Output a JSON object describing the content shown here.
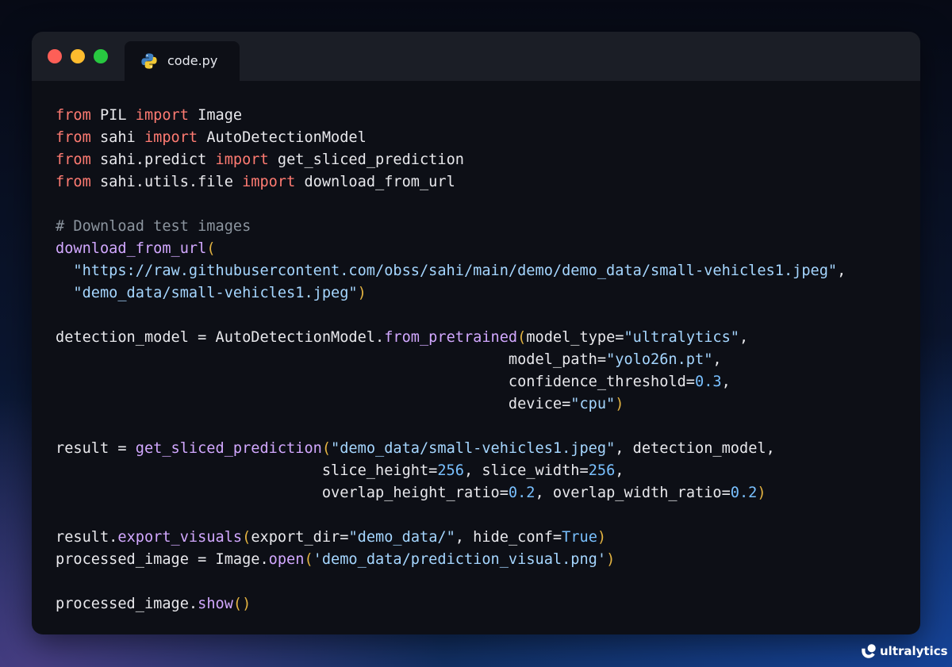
{
  "tab": {
    "label": "code.py",
    "icon": "python-icon"
  },
  "code_lines": [
    [
      [
        "kw",
        "from"
      ],
      [
        "tx",
        " PIL "
      ],
      [
        "kw",
        "import"
      ],
      [
        "tx",
        " Image"
      ]
    ],
    [
      [
        "kw",
        "from"
      ],
      [
        "tx",
        " sahi "
      ],
      [
        "kw",
        "import"
      ],
      [
        "tx",
        " AutoDetectionModel"
      ]
    ],
    [
      [
        "kw",
        "from"
      ],
      [
        "tx",
        " sahi.predict "
      ],
      [
        "kw",
        "import"
      ],
      [
        "tx",
        " get_sliced_prediction"
      ]
    ],
    [
      [
        "kw",
        "from"
      ],
      [
        "tx",
        " sahi.utils.file "
      ],
      [
        "kw",
        "import"
      ],
      [
        "tx",
        " download_from_url"
      ]
    ],
    [],
    [
      [
        "cm",
        "# Download test images"
      ]
    ],
    [
      [
        "fn",
        "download_from_url"
      ],
      [
        "pn",
        "("
      ]
    ],
    [
      [
        "tx",
        "  "
      ],
      [
        "str",
        "\"https://raw.githubusercontent.com/obss/sahi/main/demo/demo_data/small-vehicles1.jpeg\""
      ],
      [
        "tx",
        ","
      ]
    ],
    [
      [
        "tx",
        "  "
      ],
      [
        "str",
        "\"demo_data/small-vehicles1.jpeg\""
      ],
      [
        "pn",
        ")"
      ]
    ],
    [],
    [
      [
        "tx",
        "detection_model = AutoDetectionModel."
      ],
      [
        "fn",
        "from_pretrained"
      ],
      [
        "pn",
        "("
      ],
      [
        "tx",
        "model_type="
      ],
      [
        "str",
        "\"ultralytics\""
      ],
      [
        "tx",
        ","
      ]
    ],
    [
      [
        "tx",
        "                                                   model_path="
      ],
      [
        "str",
        "\"yolo26n.pt\""
      ],
      [
        "tx",
        ","
      ]
    ],
    [
      [
        "tx",
        "                                                   confidence_threshold="
      ],
      [
        "num",
        "0.3"
      ],
      [
        "tx",
        ","
      ]
    ],
    [
      [
        "tx",
        "                                                   device="
      ],
      [
        "str",
        "\"cpu\""
      ],
      [
        "pn",
        ")"
      ]
    ],
    [],
    [
      [
        "tx",
        "result = "
      ],
      [
        "fn",
        "get_sliced_prediction"
      ],
      [
        "pn",
        "("
      ],
      [
        "str",
        "\"demo_data/small-vehicles1.jpeg\""
      ],
      [
        "tx",
        ", detection_model,"
      ]
    ],
    [
      [
        "tx",
        "                              slice_height="
      ],
      [
        "num",
        "256"
      ],
      [
        "tx",
        ", slice_width="
      ],
      [
        "num",
        "256"
      ],
      [
        "tx",
        ","
      ]
    ],
    [
      [
        "tx",
        "                              overlap_height_ratio="
      ],
      [
        "num",
        "0.2"
      ],
      [
        "tx",
        ", overlap_width_ratio="
      ],
      [
        "num",
        "0.2"
      ],
      [
        "pn",
        ")"
      ]
    ],
    [],
    [
      [
        "tx",
        "result."
      ],
      [
        "fn",
        "export_visuals"
      ],
      [
        "pn",
        "("
      ],
      [
        "tx",
        "export_dir="
      ],
      [
        "str",
        "\"demo_data/\""
      ],
      [
        "tx",
        ", hide_conf="
      ],
      [
        "num",
        "True"
      ],
      [
        "pn",
        ")"
      ]
    ],
    [
      [
        "tx",
        "processed_image = Image."
      ],
      [
        "fn",
        "open"
      ],
      [
        "pn",
        "("
      ],
      [
        "str",
        "'demo_data/prediction_visual.png'"
      ],
      [
        "pn",
        ")"
      ]
    ],
    [],
    [
      [
        "tx",
        "processed_image."
      ],
      [
        "fn",
        "show"
      ],
      [
        "pn",
        "()"
      ]
    ]
  ],
  "brand": {
    "label": "ultralytics",
    "icon": "ultralytics-logo-icon"
  },
  "colors": {
    "keyword": "#ff7b72",
    "function": "#d2a8ff",
    "string": "#a5d6ff",
    "number": "#79c0ff",
    "comment": "#8b949e",
    "paren": "#e3b341",
    "text": "#e8e8ec",
    "editor_bg": "#0d0f16",
    "titlebar_bg": "#1b1e26"
  }
}
